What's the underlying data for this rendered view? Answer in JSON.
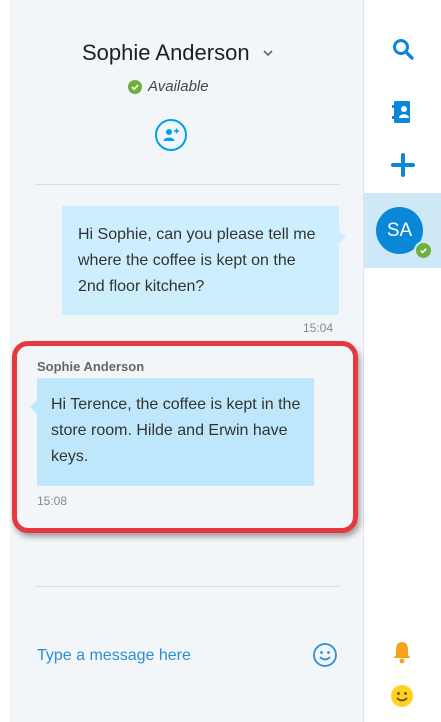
{
  "conversation": {
    "contact_name": "Sophie Anderson",
    "status": "Available",
    "icons": {
      "dropdown": "chevron-down-icon",
      "status": "check-icon",
      "add_people": "add-people-icon"
    }
  },
  "messages": [
    {
      "direction": "outgoing",
      "text": "Hi Sophie, can you please tell me where the coffee is kept on the 2nd floor kitchen?",
      "time": "15:04"
    },
    {
      "direction": "incoming",
      "sender": "Sophie Anderson",
      "text": "Hi Terence, the coffee is kept in the store room. Hilde and Erwin have keys.",
      "time": "15:08"
    }
  ],
  "composer": {
    "placeholder": "Type a message here",
    "emoji_icon": "smiley-icon"
  },
  "sidebar_rail": {
    "avatar_initials": "SA",
    "icons": [
      "search-icon",
      "contacts-icon",
      "plus-icon",
      "bell-icon",
      "smiley-icon"
    ]
  },
  "colors": {
    "accent": "#00a0f0",
    "highlight_border": "#e5393f",
    "available": "#6cb23a",
    "outgoing_bubble": "#cdeefc",
    "incoming_bubble": "#bfe7fb",
    "notification": "#f7a21b",
    "emoji": "#ffd21f"
  }
}
